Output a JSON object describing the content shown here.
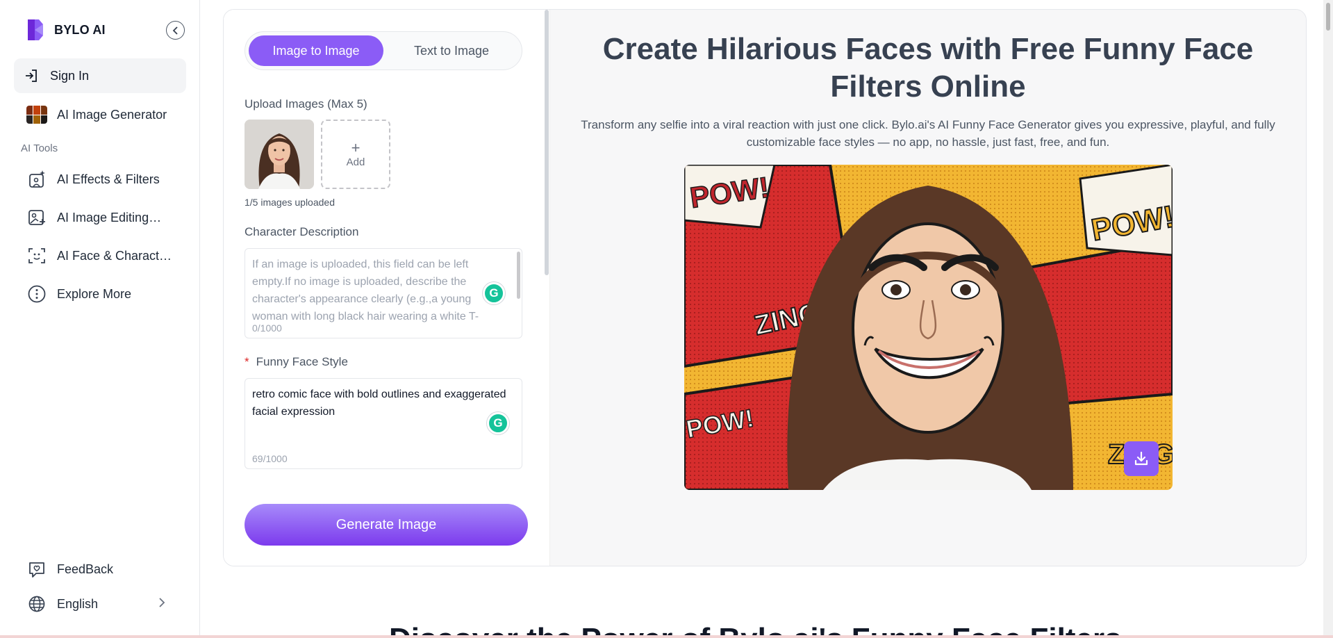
{
  "brand": {
    "name": "BYLO AI"
  },
  "sidebar": {
    "sign_in": "Sign In",
    "ai_image_generator": "AI Image Generator",
    "section_label": "AI Tools",
    "items": [
      {
        "label": "AI Effects & Filters",
        "icon": "sparkle-image-icon"
      },
      {
        "label": "AI Image Editing…",
        "icon": "image-edit-icon"
      },
      {
        "label": "AI Face & Charact…",
        "icon": "face-scan-icon"
      },
      {
        "label": "Explore More",
        "icon": "more-icon"
      }
    ],
    "feedback": "FeedBack",
    "language": "English"
  },
  "form": {
    "tabs": [
      {
        "label": "Image to Image",
        "active": true
      },
      {
        "label": "Text to Image",
        "active": false
      }
    ],
    "upload_label": "Upload Images (Max 5)",
    "add_label": "Add",
    "uploaded_note": "1/5 images uploaded",
    "char_desc_label": "Character Description",
    "char_desc_placeholder": "If an image is uploaded, this field can be left empty.If no image is uploaded, describe the character's appearance clearly (e.g.,a young woman with long black hair wearing a white T-",
    "char_desc_count": "0/1000",
    "style_required": "*",
    "style_label": "Funny Face Style",
    "style_value": "retro comic face with bold outlines and exaggerated facial expression",
    "style_count": "69/1000",
    "generate_label": "Generate Image"
  },
  "hero": {
    "title": "Create Hilarious Faces with Free Funny Face Filters Online",
    "subtitle": "Transform any selfie into a viral reaction with just one click. Bylo.ai's AI Funny Face Generator gives you expressive, playful, and fully customizable face styles — no app, no hassle, just fast, free, and fun.",
    "image_captions": [
      "POW!",
      "POW!",
      "ZING",
      "POW!",
      "ZING"
    ]
  },
  "bottom_heading": "Discover the Power of Bylo.ai's Funny Face Filters",
  "colors": {
    "accent": "#8b5cf6",
    "accent_dark": "#7c3aed",
    "comic_red": "#d62d2d",
    "comic_yellow": "#f2b632"
  }
}
